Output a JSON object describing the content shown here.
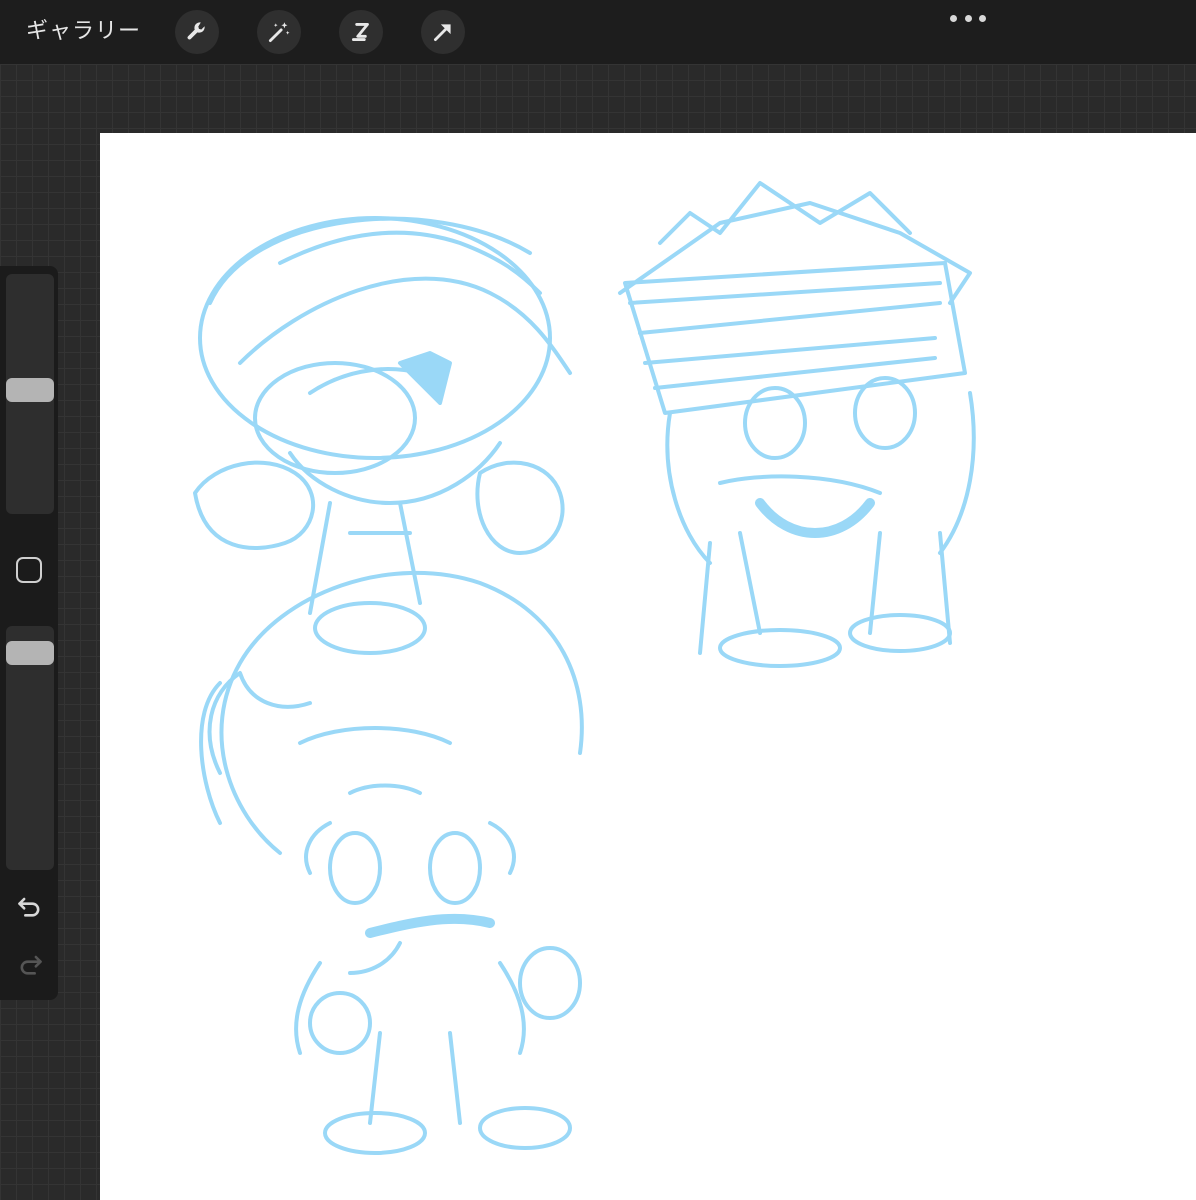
{
  "toolbar": {
    "gallery_label": "ギャラリー",
    "tools": [
      {
        "name": "actions",
        "icon": "wrench-icon"
      },
      {
        "name": "adjustments",
        "icon": "magic-wand-icon"
      },
      {
        "name": "selection",
        "icon": "selection-s-icon"
      },
      {
        "name": "transform",
        "icon": "arrow-icon"
      }
    ],
    "more_icon": "ellipsis-icon"
  },
  "sidebar": {
    "brush_size_level": 0.52,
    "opacity_level": 0.93,
    "modifier_icon": "square-icon",
    "undo_icon": "undo-icon",
    "redo_icon": "redo-icon",
    "redo_enabled": false
  },
  "canvas": {
    "content": "sketch-artwork",
    "stroke_color": "#9ad8f7",
    "background_color": "#ffffff"
  }
}
